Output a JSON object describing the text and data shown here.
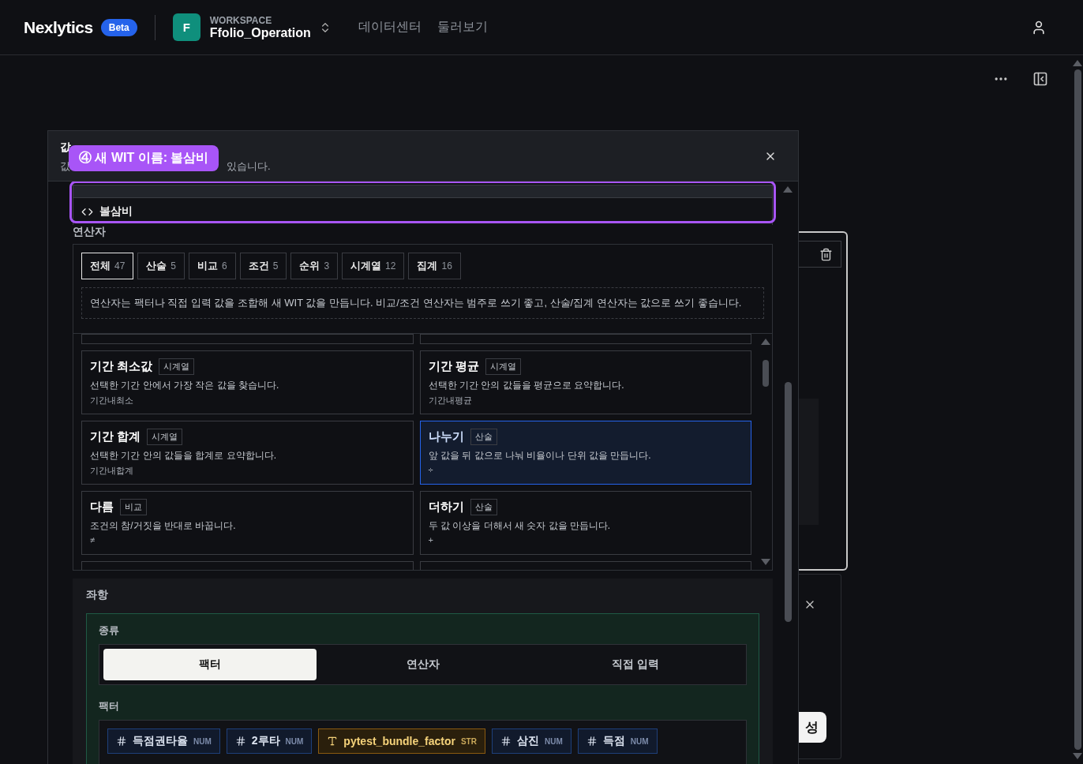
{
  "header": {
    "brand": "Nexlytics",
    "badge": "Beta",
    "workspace": {
      "avatar": "F",
      "label": "WORKSPACE",
      "name": "Ffolio_Operation"
    },
    "nav": [
      "데이터센터",
      "둘러보기"
    ]
  },
  "modal": {
    "title": "값",
    "subtitle_start": "값",
    "subtitle_end": "있습니다.",
    "callout": "④ 새 WIT 이름: 볼삼비",
    "suggestion": "볼삼비",
    "operators_label": "연산자",
    "tabs": [
      {
        "label": "전체",
        "count": "47",
        "selected": true
      },
      {
        "label": "산술",
        "count": "5",
        "selected": false
      },
      {
        "label": "비교",
        "count": "6",
        "selected": false
      },
      {
        "label": "조건",
        "count": "5",
        "selected": false
      },
      {
        "label": "순위",
        "count": "3",
        "selected": false
      },
      {
        "label": "시계열",
        "count": "12",
        "selected": false
      },
      {
        "label": "집계",
        "count": "16",
        "selected": false
      }
    ],
    "info": "연산자는 팩터나 직접 입력 값을 조합해 새 WIT 값을 만듭니다. 비교/조건 연산자는 범주로 쓰기 좋고, 산술/집계 연산자는 값으로 쓰기 좋습니다.",
    "cards": [
      {
        "name": "기간 최소값",
        "tag": "시계열",
        "desc": "선택한 기간 안에서 가장 작은 값을 찾습니다.",
        "symbol": "기간내최소",
        "selected": false
      },
      {
        "name": "기간 평균",
        "tag": "시계열",
        "desc": "선택한 기간 안의 값들을 평균으로 요약합니다.",
        "symbol": "기간내평균",
        "selected": false
      },
      {
        "name": "기간 합계",
        "tag": "시계열",
        "desc": "선택한 기간 안의 값들을 합계로 요약합니다.",
        "symbol": "기간내합계",
        "selected": false
      },
      {
        "name": "나누기",
        "tag": "산술",
        "desc": "앞 값을 뒤 값으로 나눠 비율이나 단위 값을 만듭니다.",
        "symbol": "÷",
        "selected": true
      },
      {
        "name": "다름",
        "tag": "비교",
        "desc": "조건의 참/거짓을 반대로 바꿉니다.",
        "symbol": "≠",
        "selected": false
      },
      {
        "name": "더하기",
        "tag": "산술",
        "desc": "두 값 이상을 더해서 새 숫자 값을 만듭니다.",
        "symbol": "+",
        "selected": false
      }
    ],
    "left_operand": {
      "label": "좌항",
      "kind_label": "종류",
      "segments": [
        {
          "label": "팩터",
          "selected": true
        },
        {
          "label": "연산자",
          "selected": false
        },
        {
          "label": "직접 입력",
          "selected": false
        }
      ],
      "factor_label": "팩터",
      "factors": [
        {
          "kind": "num",
          "name": "득점권타율",
          "tag": "NUM"
        },
        {
          "kind": "num",
          "name": "2루타",
          "tag": "NUM"
        },
        {
          "kind": "str",
          "name": "pytest_bundle_factor",
          "tag": "STR"
        },
        {
          "kind": "num",
          "name": "삼진",
          "tag": "NUM"
        },
        {
          "kind": "num",
          "name": "득점",
          "tag": "NUM"
        }
      ]
    }
  },
  "background": {
    "button": "성"
  }
}
